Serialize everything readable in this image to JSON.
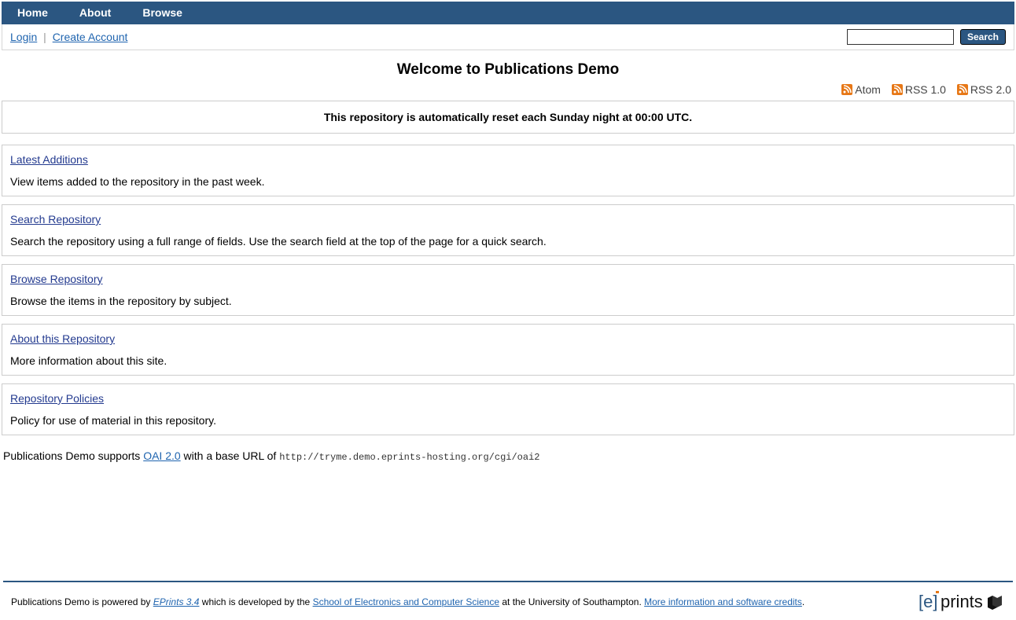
{
  "nav": {
    "items": [
      "Home",
      "About",
      "Browse"
    ]
  },
  "userbar": {
    "login": "Login",
    "create": "Create Account",
    "search_button": "Search",
    "search_placeholder": ""
  },
  "page_title": "Welcome to Publications Demo",
  "feeds": {
    "atom": "Atom",
    "rss1": "RSS 1.0",
    "rss2": "RSS 2.0"
  },
  "notice": "This repository is automatically reset each Sunday night at 00:00 UTC.",
  "cards": [
    {
      "title": "Latest Additions",
      "desc": "View items added to the repository in the past week."
    },
    {
      "title": "Search Repository",
      "desc": "Search the repository using a full range of fields. Use the search field at the top of the page for a quick search."
    },
    {
      "title": "Browse Repository",
      "desc": "Browse the items in the repository by subject."
    },
    {
      "title": "About this Repository",
      "desc": "More information about this site."
    },
    {
      "title": "Repository Policies",
      "desc": "Policy for use of material in this repository."
    }
  ],
  "oai": {
    "prefix": "Publications Demo supports ",
    "link": "OAI 2.0",
    "mid": " with a base URL of ",
    "url": "http://tryme.demo.eprints-hosting.org/cgi/oai2"
  },
  "footer": {
    "t1": "Publications Demo is powered by ",
    "eprints": "EPrints 3.4",
    "t2": " which is developed by the ",
    "school": "School of Electronics and Computer Science",
    "t3": " at the University of Southampton. ",
    "more": "More information and software credits",
    "t4": "."
  }
}
